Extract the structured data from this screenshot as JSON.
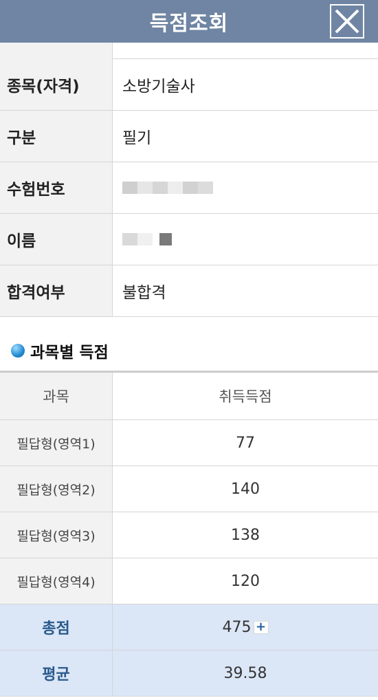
{
  "header": {
    "title": "득점조회",
    "close_icon": "close-x-icon"
  },
  "info": {
    "rows": [
      {
        "label": "종목(자격)",
        "value": "소방기술사"
      },
      {
        "label": "구분",
        "value": "필기"
      },
      {
        "label": "수험번호",
        "value": ""
      },
      {
        "label": "이름",
        "value": ""
      },
      {
        "label": "합격여부",
        "value": "불합격"
      }
    ]
  },
  "section": {
    "title": "과목별 득점"
  },
  "scores": {
    "headers": [
      "과목",
      "취득득점"
    ],
    "rows": [
      {
        "subject": "필답형(영역1)",
        "score": "77"
      },
      {
        "subject": "필답형(영역2)",
        "score": "140"
      },
      {
        "subject": "필답형(영역3)",
        "score": "138"
      },
      {
        "subject": "필답형(영역4)",
        "score": "120"
      }
    ],
    "total": {
      "label": "총점",
      "value": "475",
      "expand_symbol": "+"
    },
    "average": {
      "label": "평균",
      "value": "39.58"
    }
  },
  "colors": {
    "header_bg": "#6f85a3",
    "summary_bg": "#dbe6f7",
    "summary_label": "#2a5a8c"
  }
}
